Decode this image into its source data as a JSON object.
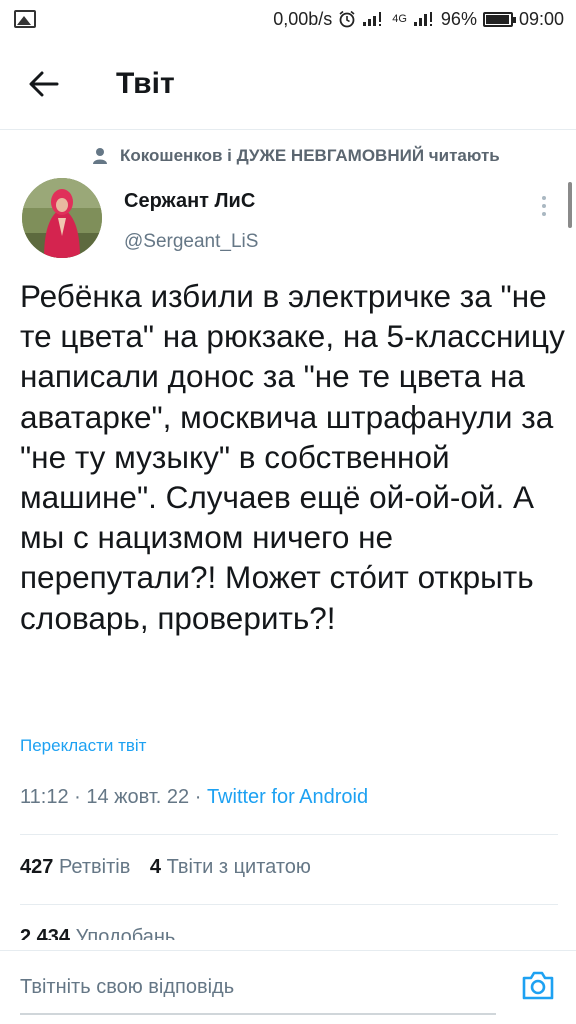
{
  "status_bar": {
    "net_speed": "0,00b/s",
    "network_label": "4G",
    "battery": "96%",
    "time": "09:00"
  },
  "app_bar": {
    "title": "Твіт",
    "back_icon": "arrow-left-icon"
  },
  "social_context": {
    "icon": "person-icon",
    "text": "Кокошенков і ДУЖЕ НЕВГАМОВНИЙ читають"
  },
  "author": {
    "name": "Сержант ЛиС",
    "handle": "@Sergeant_LiS"
  },
  "tweet": {
    "text": "Ребёнка избили в электричке за \"не те цвета\" на рюкзаке, на 5-классницу написали донос за \"не те цвета на аватарке\", москвича штрафанули за \"не ту музыку\" в собственной машине\". Случаев ещё ой-ой-ой. А мы с нацизмом ничего не перепутали?! Может сто́ит открыть словарь, проверить?!",
    "translate_label": "Перекласти твіт",
    "time": "11:12",
    "separator": " · ",
    "date": "14 жовт. 22",
    "source": "Twitter for Android"
  },
  "stats": {
    "retweets_count": "427",
    "retweets_label": "Ретвітів",
    "quotes_count": "4",
    "quotes_label": "Твіти з цитатою",
    "likes_count": "2 434",
    "likes_label": "Уподобань"
  },
  "reply": {
    "placeholder": "Твітніть свою відповідь",
    "camera_icon": "camera-icon"
  },
  "colors": {
    "accent": "#1da1f2",
    "secondary_text": "#657786",
    "divider": "#e6ecf0"
  }
}
